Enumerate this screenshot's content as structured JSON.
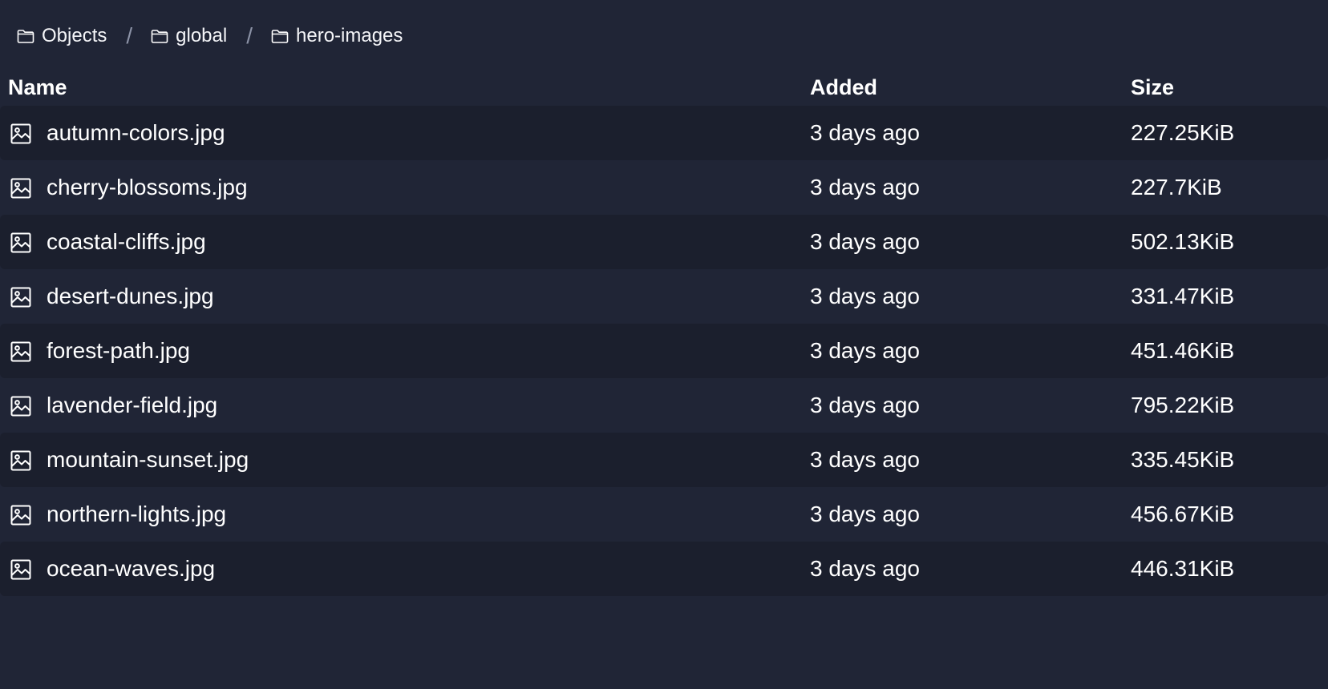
{
  "breadcrumb": [
    {
      "label": "Objects",
      "icon": "folder-icon"
    },
    {
      "label": "global",
      "icon": "folder-icon"
    },
    {
      "label": "hero-images",
      "icon": "folder-icon"
    }
  ],
  "separator": "/",
  "table": {
    "headers": {
      "name": "Name",
      "added": "Added",
      "size": "Size"
    },
    "rows": [
      {
        "name": "autumn-colors.jpg",
        "added": "3 days ago",
        "size": "227.25KiB",
        "icon": "image-file-icon"
      },
      {
        "name": "cherry-blossoms.jpg",
        "added": "3 days ago",
        "size": "227.7KiB",
        "icon": "image-file-icon"
      },
      {
        "name": "coastal-cliffs.jpg",
        "added": "3 days ago",
        "size": "502.13KiB",
        "icon": "image-file-icon"
      },
      {
        "name": "desert-dunes.jpg",
        "added": "3 days ago",
        "size": "331.47KiB",
        "icon": "image-file-icon"
      },
      {
        "name": "forest-path.jpg",
        "added": "3 days ago",
        "size": "451.46KiB",
        "icon": "image-file-icon"
      },
      {
        "name": "lavender-field.jpg",
        "added": "3 days ago",
        "size": "795.22KiB",
        "icon": "image-file-icon"
      },
      {
        "name": "mountain-sunset.jpg",
        "added": "3 days ago",
        "size": "335.45KiB",
        "icon": "image-file-icon"
      },
      {
        "name": "northern-lights.jpg",
        "added": "3 days ago",
        "size": "456.67KiB",
        "icon": "image-file-icon"
      },
      {
        "name": "ocean-waves.jpg",
        "added": "3 days ago",
        "size": "446.31KiB",
        "icon": "image-file-icon"
      }
    ]
  },
  "colors": {
    "background": "#202536",
    "row_alt": "#1b1f2d",
    "text": "#ffffff",
    "separator": "#8b92a6"
  }
}
